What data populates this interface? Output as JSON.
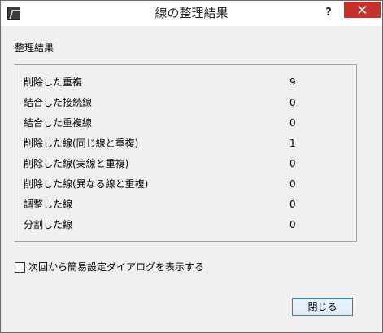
{
  "window": {
    "title": "線の整理結果",
    "help_label": "?"
  },
  "section_title": "整理結果",
  "results": [
    {
      "label": "削除した重複",
      "value": "9"
    },
    {
      "label": "結合した接続線",
      "value": "0"
    },
    {
      "label": "結合した重複線",
      "value": "0"
    },
    {
      "label": "削除した線(同じ線と重複)",
      "value": "1"
    },
    {
      "label": "削除した線(実線と重複)",
      "value": "0"
    },
    {
      "label": "削除した線(異なる線と重複)",
      "value": "0"
    },
    {
      "label": "調整した線",
      "value": "0"
    },
    {
      "label": "分割した線",
      "value": "0"
    }
  ],
  "checkbox": {
    "label": "次回から簡易設定ダイアログを表示する",
    "checked": false
  },
  "close_button_label": "閉じる",
  "colors": {
    "close_button_bg": "#c7302b",
    "window_bg": "#f0f0f0",
    "primary_button_border": "#3c7fb1"
  }
}
